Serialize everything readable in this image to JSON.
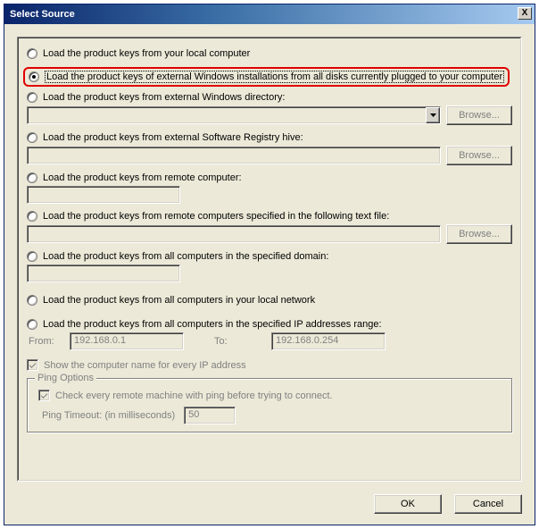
{
  "window": {
    "title": "Select Source",
    "close_glyph": "X"
  },
  "options": {
    "o1": "Load the product keys from your local computer",
    "o2": "Load the product keys of external Windows installations from all disks currently plugged to your computer",
    "o3": "Load the product keys from external Windows directory:",
    "o4": "Load the product keys from external Software Registry hive:",
    "o5": "Load the product keys from remote computer:",
    "o6": "Load the product keys from remote computers specified in the following text file:",
    "o7": "Load the product keys from all computers in the specified domain:",
    "o8": "Load the product keys from all computers in your local network",
    "o9": "Load the product keys from all computers in the specified IP addresses range:"
  },
  "buttons": {
    "browse": "Browse...",
    "ok": "OK",
    "cancel": "Cancel"
  },
  "ip": {
    "from_label": "From:",
    "to_label": "To:",
    "from_value": "192.168.0.1",
    "to_value": "192.168.0.254"
  },
  "checkboxes": {
    "show_name": "Show the computer name for every IP address"
  },
  "ping": {
    "group_title": "Ping Options",
    "check_label": "Check every remote machine with ping before trying to connect.",
    "timeout_label": "Ping Timeout: (in milliseconds)",
    "timeout_value": "50"
  }
}
